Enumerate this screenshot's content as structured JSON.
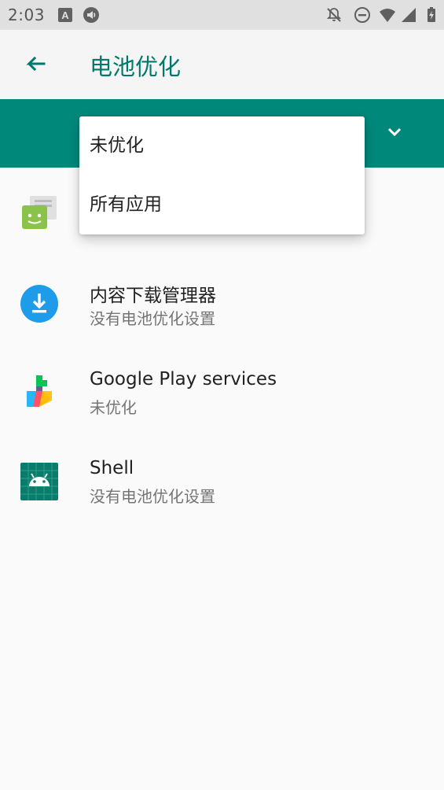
{
  "status_bar": {
    "time": "2:03",
    "icons": [
      "a11y-icon",
      "media-icon",
      "notifications-off-icon",
      "dnd-icon",
      "wifi-icon",
      "signal-icon",
      "battery-charging-icon"
    ]
  },
  "app_bar": {
    "title": "电池优化",
    "back_icon": "arrow-back-icon"
  },
  "filter": {
    "chevron_icon": "chevron-down-icon",
    "options": [
      "未优化",
      "所有应用"
    ]
  },
  "apps": [
    {
      "name": "",
      "subtitle": "",
      "icon": "messaging-app-icon"
    },
    {
      "name": "内容下载管理器",
      "subtitle": "没有电池优化设置",
      "icon": "download-manager-icon"
    },
    {
      "name": "Google Play services",
      "subtitle": "未优化",
      "icon": "google-play-services-icon"
    },
    {
      "name": "Shell",
      "subtitle": "没有电池优化设置",
      "icon": "android-shell-icon"
    }
  ],
  "colors": {
    "accent": "#00897b",
    "title": "#00796b",
    "background": "#fafafa"
  }
}
